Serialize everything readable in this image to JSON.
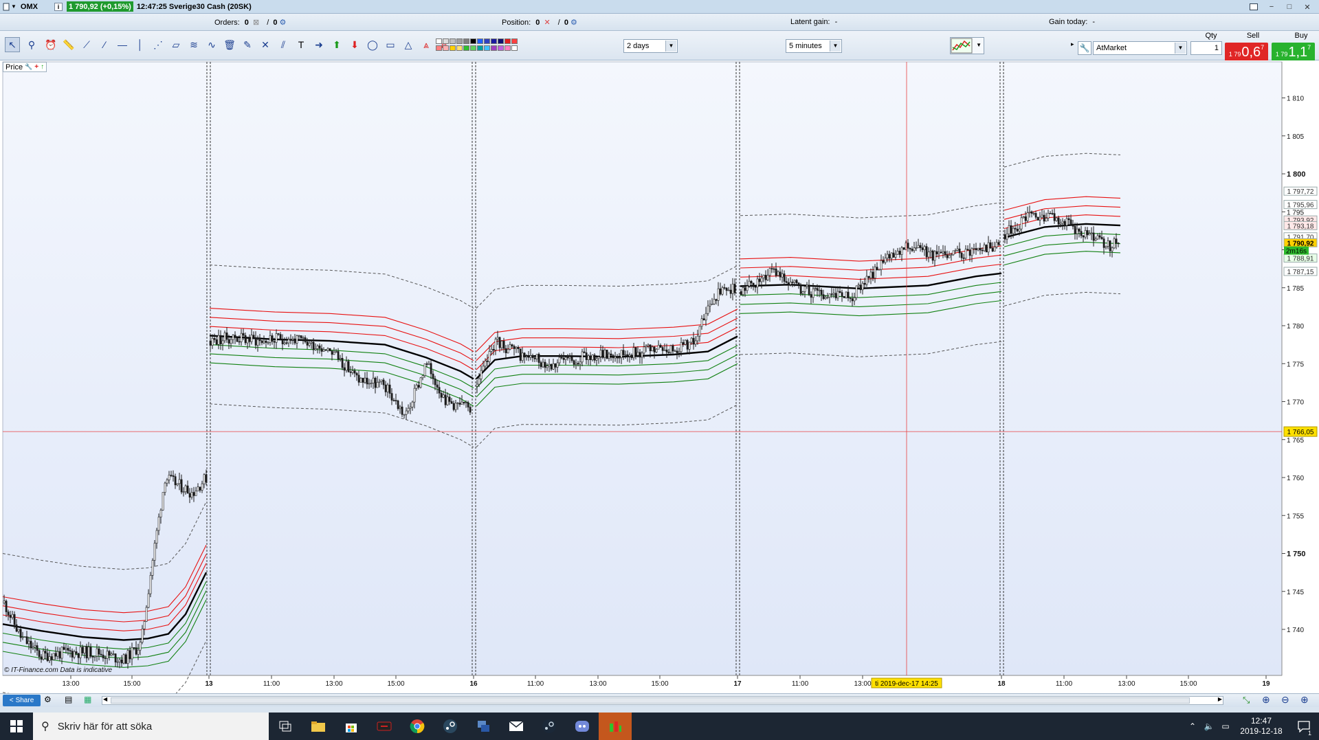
{
  "titlebar": {
    "app_name": "OMX",
    "info_badge": "i",
    "price_badge": "1 790,92 (+0,15%)",
    "time_instrument": "12:47:25  Sverige30 Cash (20SK)"
  },
  "infobar": {
    "orders_label": "Orders:",
    "orders_value": "0",
    "orders_value2": "0",
    "position_label": "Position:",
    "position_value": "0",
    "position_value2": "0",
    "latent_label": "Latent gain:",
    "latent_value": "-",
    "gain_today_label": "Gain today:",
    "gain_today_value": "-"
  },
  "toolbar": {
    "period_value": "2 days",
    "interval_value": "5 minutes",
    "tools": [
      "cursor-icon",
      "zoom-icon",
      "alarm-icon",
      "ruler-icon",
      "trendline-icon",
      "line-icon",
      "horizontal-line-icon",
      "vertical-line-icon",
      "fan-icon",
      "channel-icon",
      "regression-icon",
      "wave-icon",
      "trash-icon",
      "magic-icon",
      "cross-icon",
      "parallel-icon",
      "text-icon",
      "arrow-right-icon",
      "arrow-up-icon",
      "arrow-down-icon",
      "ellipse-icon",
      "rectangle-icon",
      "triangle-icon",
      "fib-icon",
      "pitchfork-icon"
    ],
    "palette": [
      "#ffffff",
      "#dcdcdc",
      "#c0c0c0",
      "#a0a0a0",
      "#808080",
      "#000000",
      "#2060ff",
      "#3040c0",
      "#1a1aa0",
      "#101070",
      "#e02020",
      "#ff4040",
      "#ff8080",
      "#ffb0b0",
      "#ffd000",
      "#ffe070",
      "#30c030",
      "#60d060",
      "#00a0a0",
      "#40c0ff",
      "#a040c0",
      "#c060e0",
      "#ff80c0",
      "#ffffff"
    ]
  },
  "trade": {
    "order_type": "AtMarket",
    "qty_label": "Qty",
    "qty_value": "1",
    "sell_label": "Sell",
    "sell_small": "1 79",
    "sell_big": "0,6",
    "sell_sup": "7",
    "buy_label": "Buy",
    "buy_small": "1 79",
    "buy_big": "1,1",
    "buy_sup": "7"
  },
  "chart": {
    "panel_label": "Price",
    "watermark": "© IT-Finance.com  Data is indicative",
    "crosshair_date_label": "ti 2019-dec-17 14:25",
    "crosshair_price_label": "1 766,05",
    "last_price_label": "1 790,92",
    "timer_label": "2m16s",
    "right_labels": [
      "1 797,72",
      "1 795,96",
      "1 793,92",
      "1 793,18",
      "1 791,70",
      "1 790,92",
      "1 788,91",
      "1 787,15"
    ],
    "y_ticks": [
      "1 810",
      "1 805",
      "1 800",
      "1 795",
      "1 790",
      "1 785",
      "1 780",
      "1 775",
      "1 770",
      "1 765",
      "1 760",
      "1 755",
      "1 750",
      "1 745",
      "1 740"
    ],
    "x_ticks": [
      "13:00",
      "15:00",
      "13",
      "11:00",
      "13:00",
      "15:00",
      "16",
      "11:00",
      "13:00",
      "15:00",
      "17",
      "11:00",
      "13:00",
      "18",
      "11:00",
      "13:00",
      "15:00",
      "19"
    ],
    "colors": {
      "bg_top": "#f4f7fd",
      "bg_bottom": "#dfe7f8",
      "mid_line": "#000000",
      "upper_band": "#e81010",
      "lower_band": "#108010",
      "outer_band": "#555555",
      "crosshair": "#e84040",
      "candle": "#1a1a1a"
    }
  },
  "bottombar": {
    "share_label": "Share"
  },
  "taskbar": {
    "search_placeholder": "Skriv här för att söka",
    "time": "12:47",
    "date": "2019-12-18",
    "notification_count": "1"
  }
}
